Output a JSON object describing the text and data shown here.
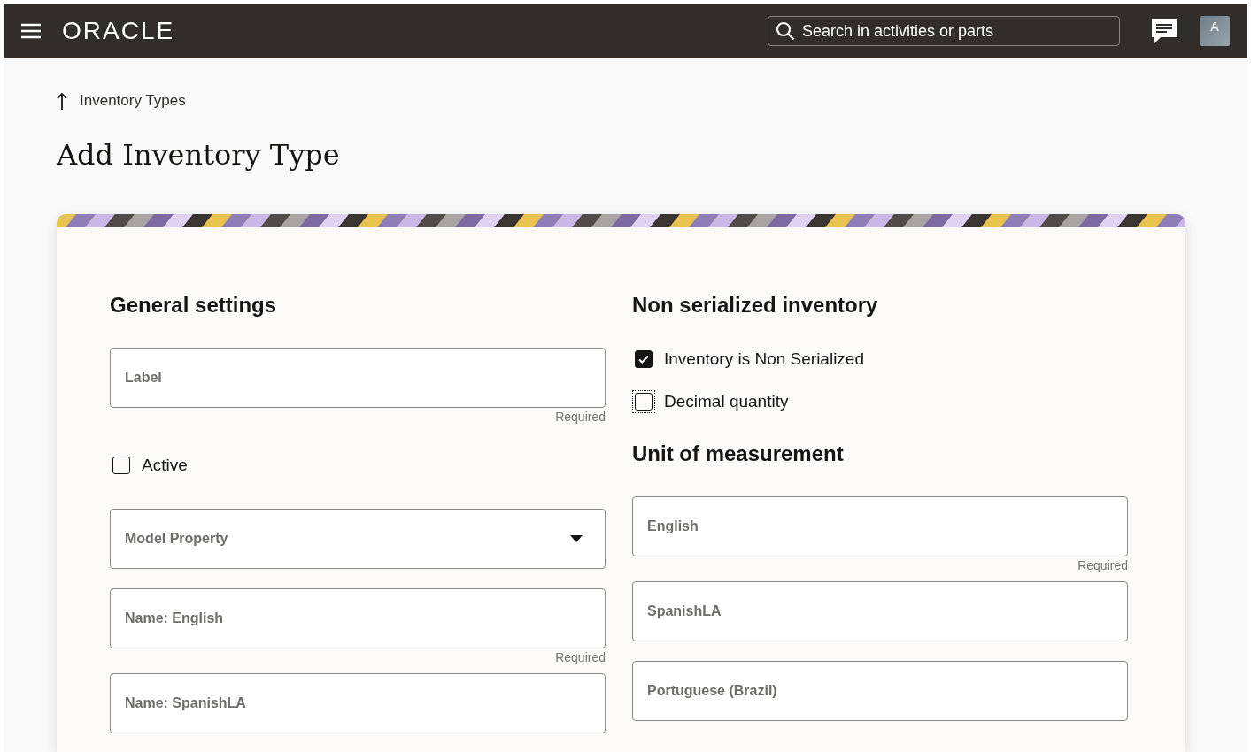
{
  "header": {
    "logo": "ORACLE",
    "search": {
      "placeholder": "Search in activities or parts"
    },
    "avatar": "A"
  },
  "breadcrumb": "Inventory Types",
  "title": "Add Inventory Type",
  "left": {
    "heading": "General settings",
    "items": [
      {
        "kind": "field",
        "placeholder": "Label",
        "hint": "Required"
      },
      {
        "kind": "checkbox",
        "label": "Active",
        "checked": false,
        "focused": false
      },
      {
        "kind": "select",
        "placeholder": "Model Property"
      },
      {
        "kind": "field",
        "placeholder": "Name: English",
        "hint": "Required"
      },
      {
        "kind": "field",
        "placeholder": "Name: SpanishLA"
      }
    ]
  },
  "right": {
    "heading": "Non serialized inventory",
    "items": [
      {
        "kind": "checkbox",
        "label": "Inventory is Non Serialized",
        "checked": true,
        "focused": false
      },
      {
        "kind": "checkbox",
        "label": "Decimal quantity",
        "checked": false,
        "focused": true
      },
      {
        "kind": "heading",
        "label": "Unit of measurement"
      },
      {
        "kind": "field",
        "placeholder": "English",
        "hint": "Required"
      },
      {
        "kind": "field",
        "placeholder": "SpanishLA"
      },
      {
        "kind": "field",
        "placeholder": "Portuguese (Brazil)"
      }
    ]
  }
}
